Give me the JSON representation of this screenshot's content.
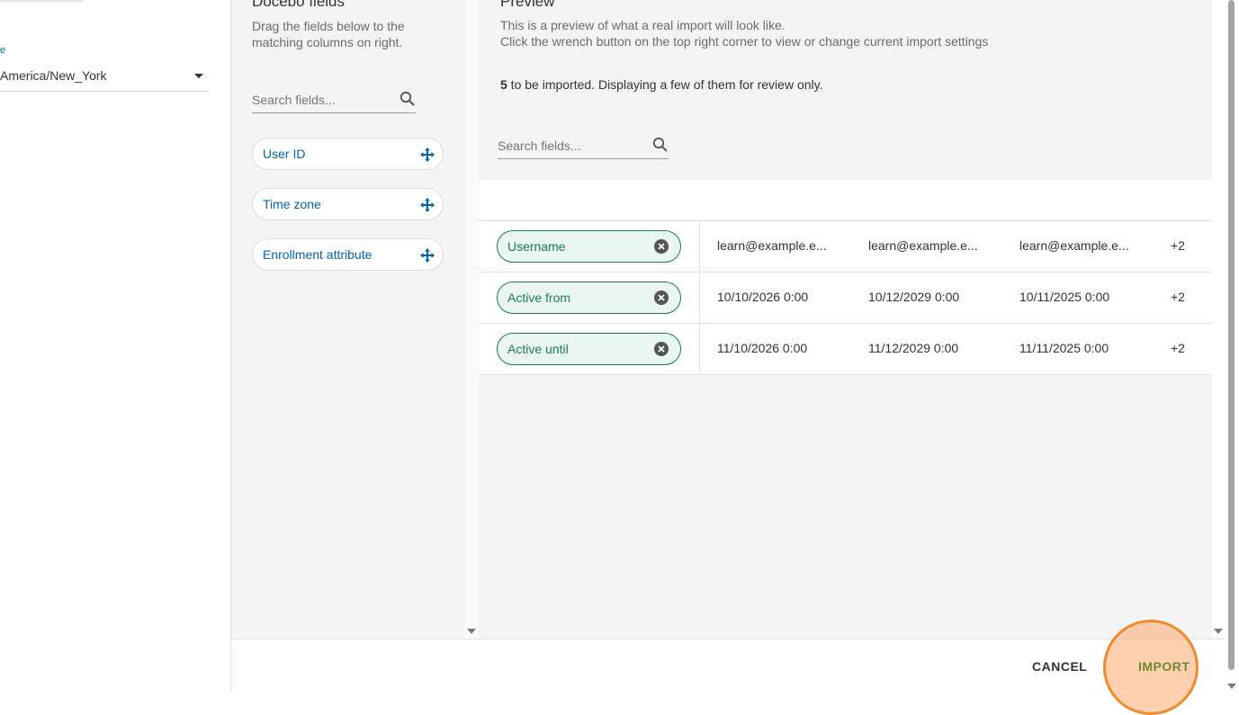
{
  "left_panel": {
    "timezone_label": "e",
    "timezone_value": "America/New_York"
  },
  "fields_panel": {
    "title": "Docebo fields",
    "description": "Drag the fields below to the matching columns on right.",
    "search_placeholder": "Search fields...",
    "fields": [
      {
        "label": "User ID"
      },
      {
        "label": "Time zone"
      },
      {
        "label": "Enrollment attribute"
      }
    ]
  },
  "preview_panel": {
    "title": "Preview",
    "description_line1": "This is a preview of what a real import will look like.",
    "description_line2": "Click the wrench button on the top right corner to view or change current import settings",
    "count": "5",
    "count_text": " to be imported. Displaying a few of them for review only.",
    "search_placeholder": "Search fields...",
    "rows": [
      {
        "field": "Username",
        "values": [
          "learn@example.e...",
          "learn@example.e...",
          "learn@example.e..."
        ],
        "more": "+2"
      },
      {
        "field": "Active from",
        "values": [
          "10/10/2026 0:00",
          "10/12/2029 0:00",
          "10/11/2025 0:00"
        ],
        "more": "+2"
      },
      {
        "field": "Active until",
        "values": [
          "11/10/2026 0:00",
          "11/12/2029 0:00",
          "11/11/2025 0:00"
        ],
        "more": "+2"
      }
    ]
  },
  "footer": {
    "cancel_label": "CANCEL",
    "import_label": "IMPORT"
  },
  "colors": {
    "accent_blue": "#0465ac",
    "mapped_green": "#1b7a5a",
    "highlight_orange": "#f08a2e"
  },
  "icons": {
    "search": "search-icon",
    "move": "move-icon",
    "remove": "remove-icon",
    "caret": "chevron-down-icon"
  }
}
